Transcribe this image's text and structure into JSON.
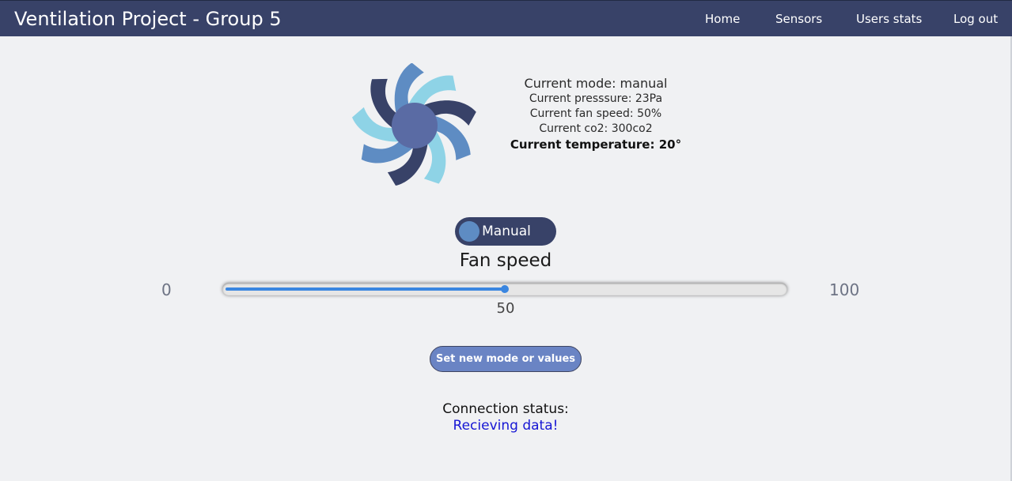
{
  "navbar": {
    "title": "Ventilation Project - Group 5",
    "links": [
      "Home",
      "Sensors",
      "Users stats",
      "Log out"
    ]
  },
  "fan": {
    "icon": "fan-icon",
    "colors": {
      "dark": "#384268",
      "mid": "#5e8cc3",
      "light": "#8ed3e6",
      "hub": "#5a6ba4"
    }
  },
  "status": {
    "mode": "Current mode: manual",
    "pressure": "Current presssure: 23Pa",
    "fan_speed": "Current fan speed: 50%",
    "co2": "Current co2: 300co2",
    "temperature": "Current temperature: 20°"
  },
  "mode_toggle": {
    "label": "Manual",
    "state": "manual"
  },
  "fan_speed_control": {
    "title": "Fan speed",
    "min_label": "0",
    "max_label": "100",
    "min": 0,
    "max": 100,
    "value": 50,
    "value_label": "50"
  },
  "submit_button": {
    "label": "Set new mode or values"
  },
  "connection": {
    "label": "Connection status:",
    "value": "Recieving data!",
    "value_color": "#1616d4"
  }
}
